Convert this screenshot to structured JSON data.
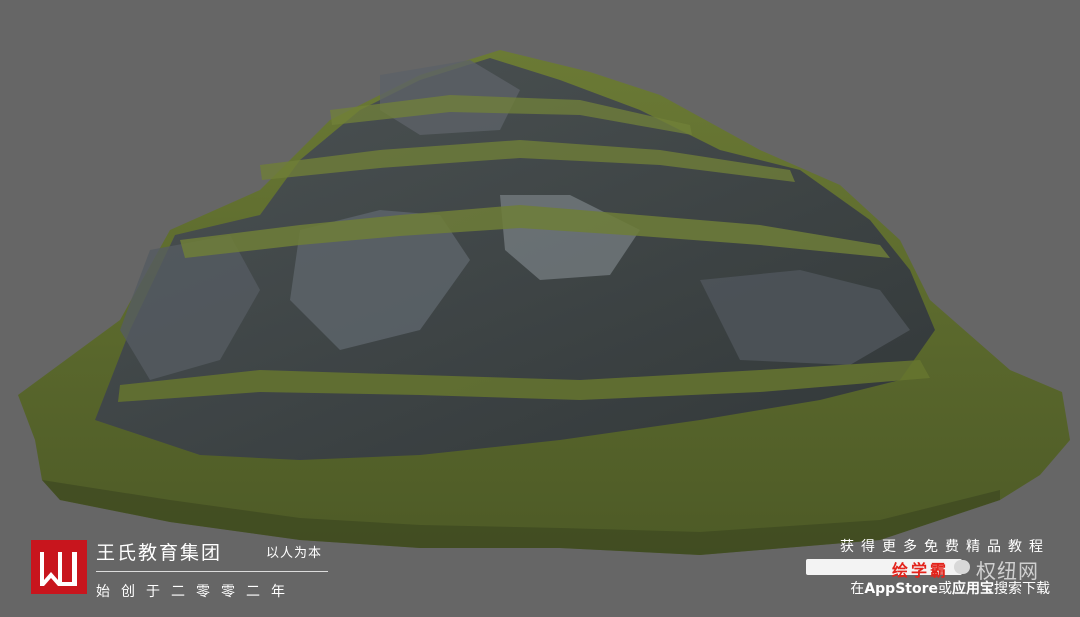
{
  "scene": {
    "subject": "mountain-terrain-3d-render",
    "colors": {
      "background": "#666666",
      "grass": "#5a6a2e",
      "rock": "#3b4047",
      "rock_light": "#6f767a"
    }
  },
  "brand": {
    "logo_text": "W",
    "name": "王氏教育集团",
    "tagline": "以人为本",
    "founded": "始创于二零零二年",
    "color": "#c8151d"
  },
  "promo": {
    "title": "获得更多免费精品教程",
    "badge": "绘学霸",
    "watermark": "权纽网",
    "footer_prefix": "在",
    "footer_store1": "AppStore",
    "footer_or": "或",
    "footer_store2": "应用宝",
    "footer_suffix": "搜索下载"
  }
}
